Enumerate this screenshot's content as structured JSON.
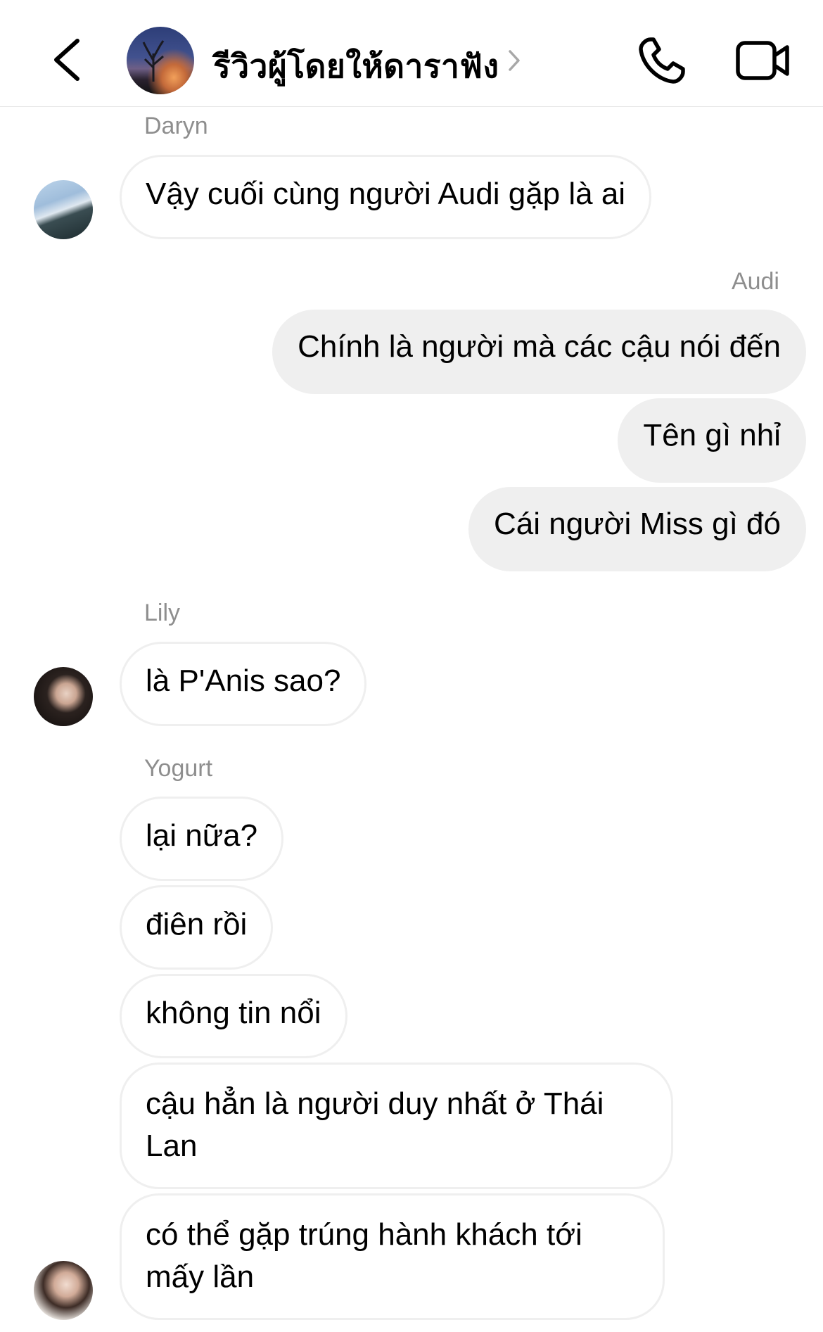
{
  "header": {
    "title": "รีวิวผู้โดยให้ดาราฟัง",
    "back_icon": "chevron-left-icon",
    "call_icon": "phone-icon",
    "video_icon": "video-camera-icon"
  },
  "messages": [
    {
      "sender": "Daryn",
      "direction": "incoming",
      "texts": [
        "Vậy cuối cùng người Audi gặp là ai"
      ]
    },
    {
      "sender": "Audi",
      "direction": "outgoing",
      "texts": [
        "Chính là người mà các cậu nói đến",
        "Tên gì nhỉ",
        "Cái người Miss gì đó"
      ]
    },
    {
      "sender": "Lily",
      "direction": "incoming",
      "texts": [
        "là P'Anis sao?"
      ]
    },
    {
      "sender": "Yogurt",
      "direction": "incoming",
      "texts": [
        "lại nữa?",
        "điên rồi",
        "không tin nổi",
        "cậu hẳn là người duy nhất ở Thái Lan",
        "có thể gặp trúng hành khách tới mấy lần"
      ]
    }
  ],
  "colors": {
    "outgoing_bubble": "#efefef",
    "incoming_border": "#efefef",
    "sender_label": "#8e8e8e"
  }
}
